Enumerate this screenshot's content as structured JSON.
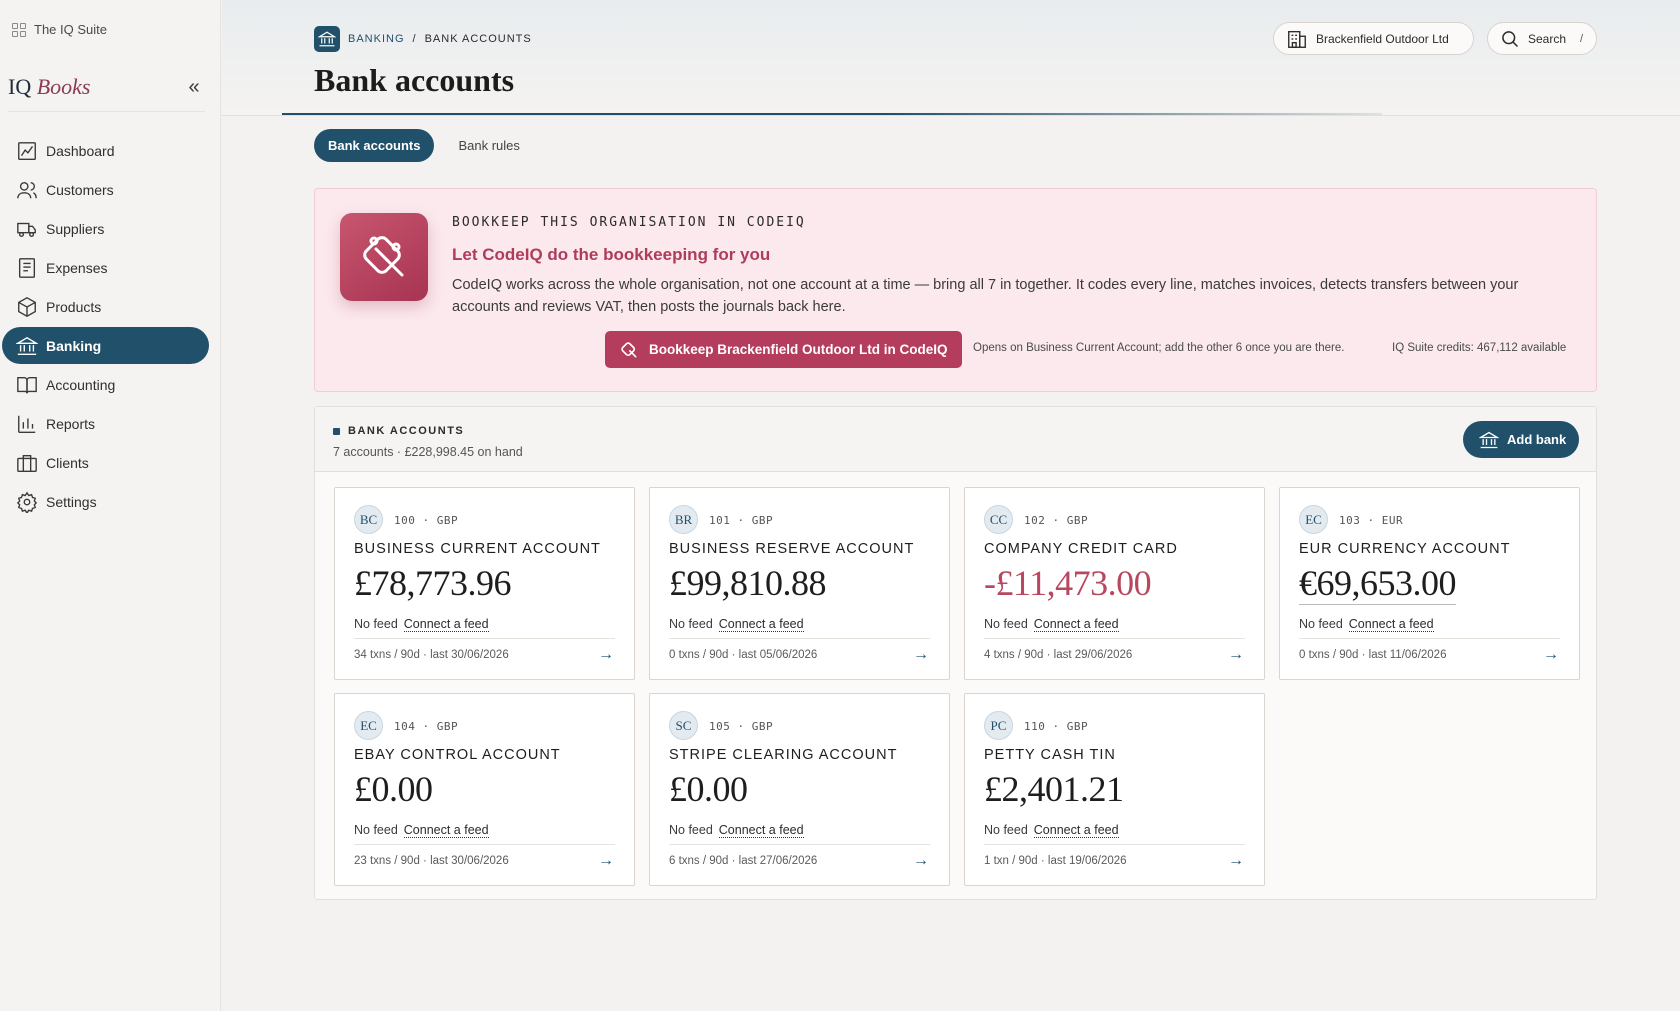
{
  "sidebar": {
    "suite_label": "The IQ Suite",
    "brand_prefix": "IQ",
    "brand_suffix": "Books",
    "collapse_glyph": "«",
    "items": [
      {
        "label": "Dashboard",
        "icon": "dashboard-icon"
      },
      {
        "label": "Customers",
        "icon": "customers-icon"
      },
      {
        "label": "Suppliers",
        "icon": "truck-icon"
      },
      {
        "label": "Expenses",
        "icon": "receipt-icon"
      },
      {
        "label": "Products",
        "icon": "box-icon"
      },
      {
        "label": "Banking",
        "icon": "bank-icon"
      },
      {
        "label": "Accounting",
        "icon": "book-icon"
      },
      {
        "label": "Reports",
        "icon": "bar-chart-icon"
      },
      {
        "label": "Clients",
        "icon": "briefcase-icon"
      },
      {
        "label": "Settings",
        "icon": "gear-icon"
      }
    ],
    "active_item": "Banking"
  },
  "header": {
    "breadcrumb_root": "BANKING",
    "breadcrumb_sep": "/",
    "breadcrumb_current": "BANK ACCOUNTS",
    "title": "Bank accounts",
    "org_name": "Brackenfield Outdoor Ltd",
    "search_label": "Search",
    "search_shortcut": "/"
  },
  "tabs": [
    {
      "label": "Bank accounts",
      "active": true
    },
    {
      "label": "Bank rules",
      "active": false
    }
  ],
  "promo": {
    "eyebrow": "BOOKKEEP THIS ORGANISATION IN CODEIQ",
    "heading": "Let CodeIQ do the bookkeeping for you",
    "body": "CodeIQ works across the whole organisation, not one account at a time — bring all 7 in together. It codes every line, matches invoices, detects transfers between your accounts and reviews VAT, then posts the journals back here.",
    "button_label": "Bookkeep Brackenfield Outdoor Ltd in CodeIQ",
    "note": "Opens on Business Current Account; add the other 6 once you are there.",
    "credits": "IQ Suite credits: 467,112 available"
  },
  "accounts_panel": {
    "title": "BANK ACCOUNTS",
    "summary": "7 accounts · £228,998.45 on hand",
    "add_button": "Add bank",
    "feed_status": "No feed",
    "connect_label": "Connect a feed",
    "cards": [
      {
        "initials": "BC",
        "code": "100 · GBP",
        "name": "BUSINESS CURRENT ACCOUNT",
        "balance": "£78,773.96",
        "negative": false,
        "meta": "34 txns / 90d · last 30/06/2026"
      },
      {
        "initials": "BR",
        "code": "101 · GBP",
        "name": "BUSINESS RESERVE ACCOUNT",
        "balance": "£99,810.88",
        "negative": false,
        "meta": "0 txns / 90d · last 05/06/2026"
      },
      {
        "initials": "CC",
        "code": "102 · GBP",
        "name": "COMPANY CREDIT CARD",
        "balance": "-£11,473.00",
        "negative": true,
        "meta": "4 txns / 90d · last 29/06/2026"
      },
      {
        "initials": "EC",
        "code": "103 · EUR",
        "name": "EUR CURRENCY ACCOUNT",
        "balance": "€69,653.00",
        "negative": false,
        "meta": "0 txns / 90d · last 11/06/2026"
      },
      {
        "initials": "EC",
        "code": "104 · GBP",
        "name": "EBAY CONTROL ACCOUNT",
        "balance": "£0.00",
        "negative": false,
        "meta": "23 txns / 90d · last 30/06/2026"
      },
      {
        "initials": "SC",
        "code": "105 · GBP",
        "name": "STRIPE CLEARING ACCOUNT",
        "balance": "£0.00",
        "negative": false,
        "meta": "6 txns / 90d · last 27/06/2026"
      },
      {
        "initials": "PC",
        "code": "110 · GBP",
        "name": "PETTY CASH TIN",
        "balance": "£2,401.21",
        "negative": false,
        "meta": "1 txn / 90d · last 19/06/2026"
      }
    ]
  },
  "colors": {
    "accent": "#21506b",
    "promo_accent": "#b43c5c",
    "promo_bg": "#fbe9ed",
    "negative": "#b8485f"
  }
}
